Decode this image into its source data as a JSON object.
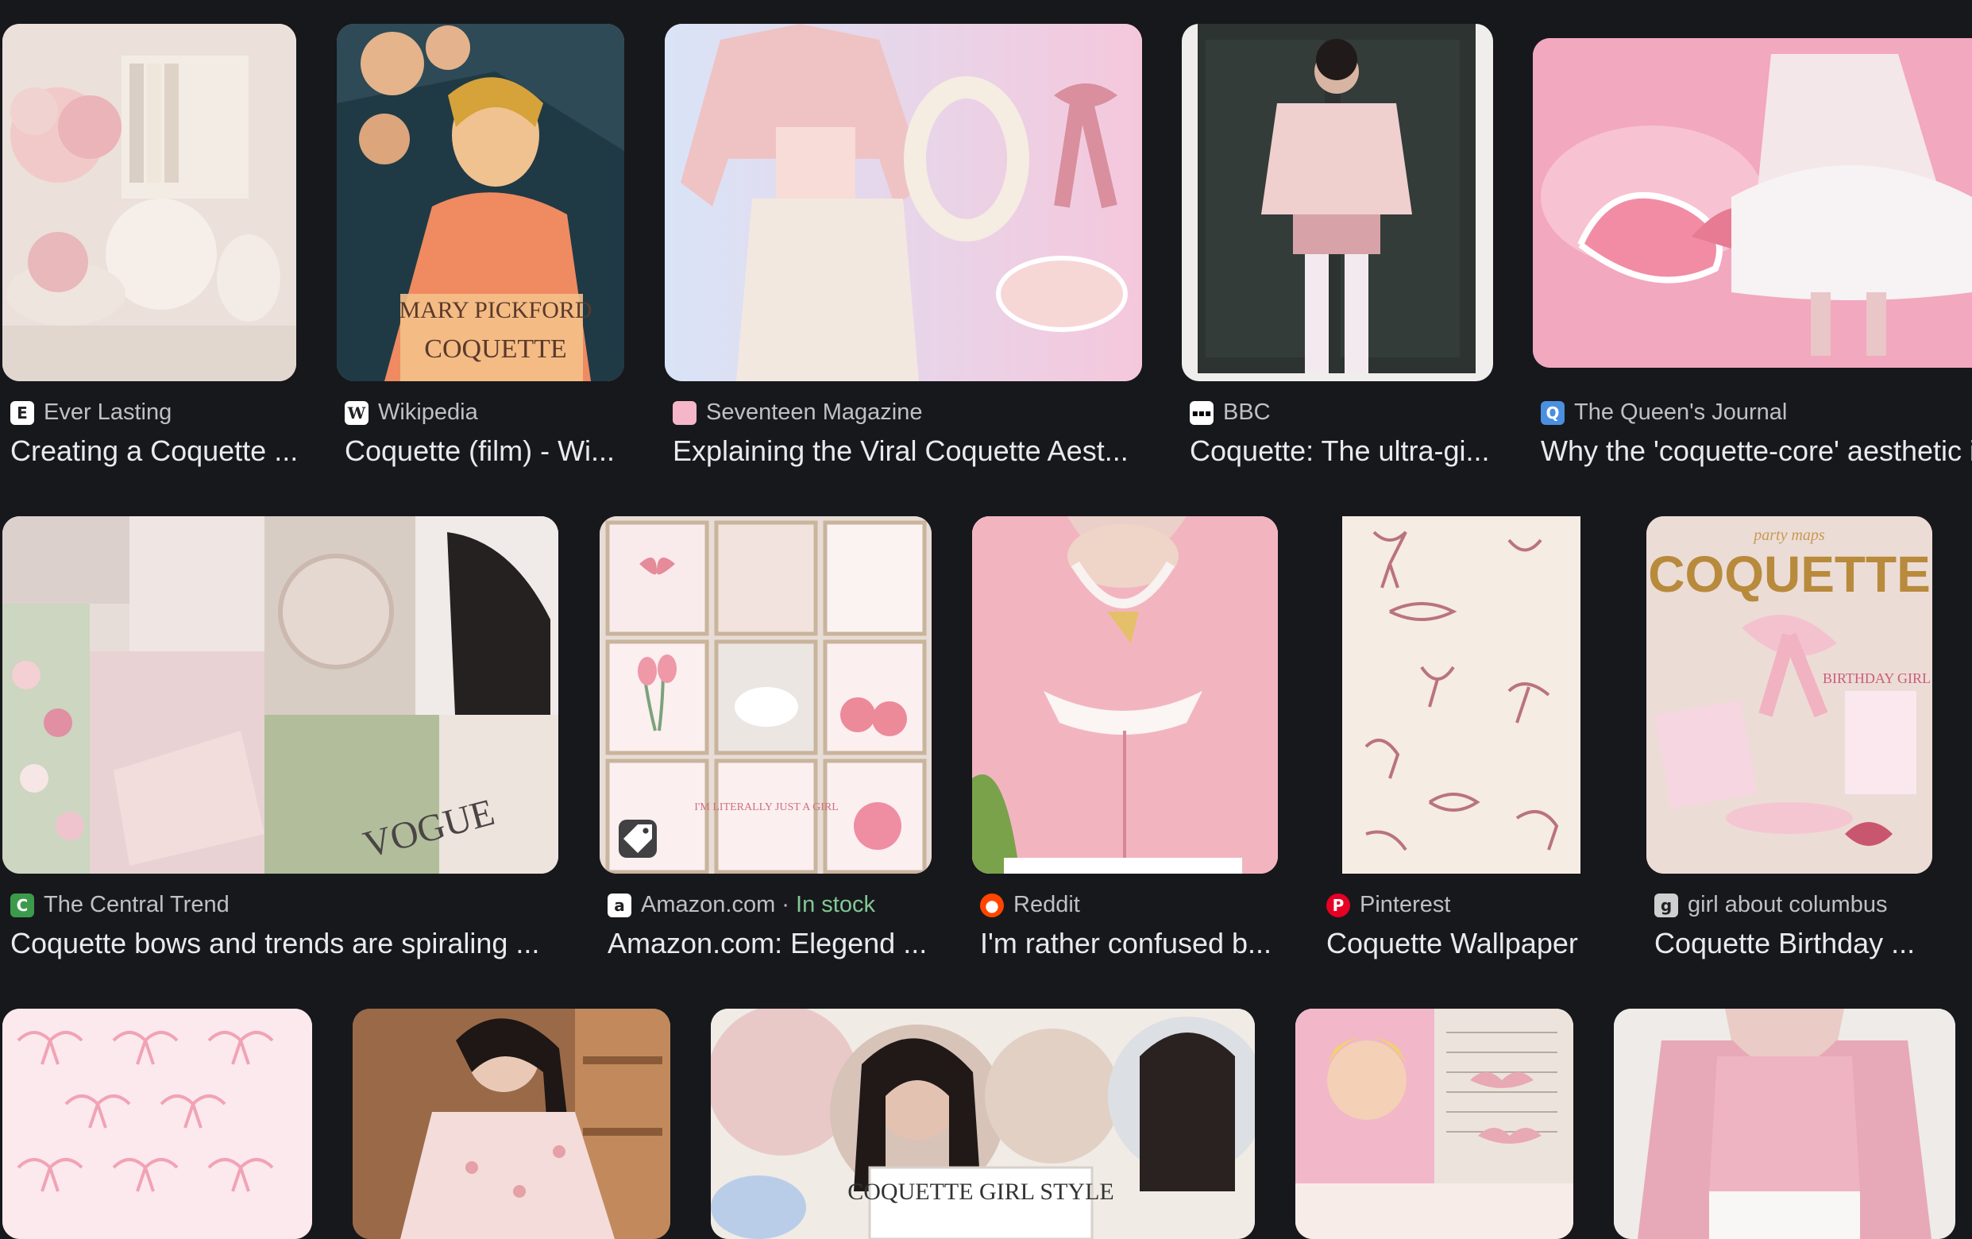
{
  "results": [
    {
      "source": "Ever Lasting",
      "title": "Creating a Coquette ...",
      "favicon": "E",
      "favicon_bg": "#ffffff",
      "favicon_fg": "#202124"
    },
    {
      "source": "Wikipedia",
      "title": "Coquette (film) - Wi...",
      "favicon": "W",
      "favicon_bg": "#ffffff",
      "favicon_fg": "#202124"
    },
    {
      "source": "Seventeen Magazine",
      "title": "Explaining the Viral Coquette Aest...",
      "favicon": "",
      "favicon_bg": "#f4b6c8",
      "favicon_fg": "#ffffff"
    },
    {
      "source": "BBC",
      "title": "Coquette: The ultra-gi...",
      "favicon": "▪▪▪",
      "favicon_bg": "#ffffff",
      "favicon_fg": "#000000"
    },
    {
      "source": "The Queen's Journal",
      "title": "Why the 'coquette-core' aesthetic i",
      "favicon": "Q",
      "favicon_bg": "#4a8fe0",
      "favicon_fg": "#ffffff"
    },
    {
      "source": "The Central Trend",
      "title": "Coquette bows and trends are spiraling ...",
      "favicon": "C",
      "favicon_bg": "#3c9a4c",
      "favicon_fg": "#ffffff"
    },
    {
      "source": "Amazon.com",
      "source_extra": " · ",
      "stock": "In stock",
      "title": "Amazon.com: Elegend ...",
      "favicon": "a",
      "favicon_bg": "#ffffff",
      "favicon_fg": "#202124"
    },
    {
      "source": "Reddit",
      "title": "I'm rather confused b...",
      "favicon": "●",
      "favicon_bg": "#ff4500",
      "favicon_fg": "#ffffff"
    },
    {
      "source": "Pinterest",
      "title": "Coquette Wallpaper",
      "favicon": "P",
      "favicon_bg": "#e60023",
      "favicon_fg": "#ffffff"
    },
    {
      "source": "girl about columbus",
      "title": "Coquette Birthday ...",
      "favicon": "g",
      "favicon_bg": "#cfcfcf",
      "favicon_fg": "#202124"
    }
  ],
  "image_text": {
    "poster_name": "MARY PICKFORD",
    "poster_title": "COQUETTE",
    "collage_text": "VOGUE",
    "birthday_header": "party maps",
    "birthday_title": "COQUETTE",
    "birthday_sub": "BIRTHDAY GIRL",
    "print_text": "I'M LITERALLY JUST A GIRL",
    "style_banner": "COQUETTE GIRL STYLE"
  },
  "colors": {
    "background": "#17181c",
    "source_text": "#bdc1c6",
    "title_text": "#e8eaed",
    "in_stock": "#81c995"
  }
}
